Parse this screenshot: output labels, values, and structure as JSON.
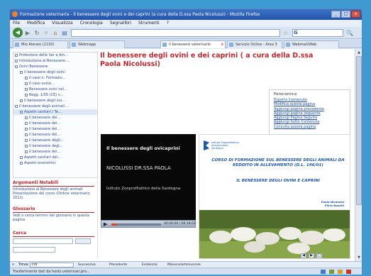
{
  "window": {
    "title": "Formazione veterinaria - Il benessere degli ovini e dei caprini (a cura della D.ssa Paola Nicolussi) - Mozilla Firefox",
    "buttons": {
      "minimize": "_",
      "maximize": "□",
      "close": "x"
    }
  },
  "menu": [
    "File",
    "Modifica",
    "Visualizza",
    "Cronologia",
    "Segnalibri",
    "Strumenti",
    "?"
  ],
  "nav": {
    "back": "◀",
    "forward": "▶",
    "reload": "↻",
    "stop": "✕",
    "home": "⌂",
    "page": "▤",
    "star": "☆",
    "search_prefix": "G",
    "search_go": "🔍"
  },
  "tabs": [
    {
      "label": "Mio Ateneo (1110)"
    },
    {
      "label": "Webmapp"
    },
    {
      "label": "Il benessere veterinario",
      "active": true,
      "close": "x"
    },
    {
      "label": "Servizio Online - Area 3"
    },
    {
      "label": "Webmail/Web"
    }
  ],
  "sidebar": {
    "tree": [
      {
        "label": "Protezione delle Ser e Am...",
        "level": 1
      },
      {
        "label": "Introduzione al Benessere ...",
        "level": 1
      },
      {
        "label": "Ovini Benessere",
        "level": 1
      },
      {
        "label": "Il benessere degli ovini",
        "level": 2
      },
      {
        "label": "Il caso n. Formazio...",
        "level": 3
      },
      {
        "label": "Il caso ovino...",
        "level": 3
      },
      {
        "label": "Benessere ovini nel...",
        "level": 3
      },
      {
        "label": "Regg. 1/05 (CE) n...",
        "level": 3
      },
      {
        "label": "Il benessere degli ovi...",
        "level": 2
      },
      {
        "label": "Il benessere degli animali ...",
        "level": 1
      },
      {
        "label": "Aspetti sanitari / Te...",
        "level": 2,
        "selected": true
      },
      {
        "label": "Il benessere del...",
        "level": 3
      },
      {
        "label": "Il benessere del...",
        "level": 3
      },
      {
        "label": "Il benessere del...",
        "level": 3
      },
      {
        "label": "Il benessere del...",
        "level": 3
      },
      {
        "label": "Il benessere degli...",
        "level": 3
      },
      {
        "label": "Il benessere degl...",
        "level": 3
      },
      {
        "label": "Il benessere del...",
        "level": 3
      },
      {
        "label": "Aspetti sanitari del...",
        "level": 2
      },
      {
        "label": "Aspetti economici",
        "level": 2
      }
    ],
    "related_title": "Argomenti Notabili",
    "related_items": [
      "Introduzione al Benessere degli animali",
      "Presentazione del corso (Ordine veterinario 2011)"
    ],
    "glossary_title": "Glossario",
    "glossary_text": "Vedi o cerca termini del glossario in questa pagina",
    "search_title": "Cerca"
  },
  "page": {
    "title": "Il benessere degli ovini e dei caprini ( a cura della D.ssa Paola Nicolussi)"
  },
  "overview": {
    "title": "Panoramica",
    "links": [
      "Esporta Contenuto",
      "Modifica questa pagina",
      "Aggiungi pagina precedente",
      "Aggiungi pagina seguente",
      "Aggiungi Pagina Seguita",
      "Aggiungi Sotto Contenuto",
      "Consulta questa pagina"
    ]
  },
  "video": {
    "title": "Il benessere degli ovicaprini",
    "author": "NICOLUSSI DR.SSA PAOLA",
    "institute": "Istituto Zooprofilattico della Sardegna",
    "time": "00:00:00 / 00:18:02",
    "progress": 0.12,
    "play": "▶"
  },
  "slide": {
    "logo_text": "Istituto Zooprofilattico Sperimentale Sardegna",
    "heading": "CORSO DI FORMAZIONE SUL BENESSERE DEGLI ANIMALI DA REDDITO IN ALLEVAMENTO (D.L. 146/01)",
    "subheading": "IL BENESSERE DEGLI OVINI E CAPRINI",
    "names": [
      "Paola Nicolussi",
      "Piero Bonelli"
    ],
    "controls": [
      "◀",
      "▶",
      "□"
    ]
  },
  "scrollbar": {
    "up": "▲",
    "down": "▼"
  },
  "findbar": {
    "close": "x",
    "label": "Trova:",
    "value": "cor",
    "next": "Successivo",
    "prev": "Precedente",
    "highlight": "Evidenzia",
    "match_case": "Maiuscole/minuscole"
  },
  "status": {
    "text": "Trasferimento dati da hosts.veterinari.pro..."
  },
  "colors": {
    "title_red": "#c0272d",
    "link_blue": "#1f4ea8",
    "slide_blue": "#1c55a7"
  }
}
